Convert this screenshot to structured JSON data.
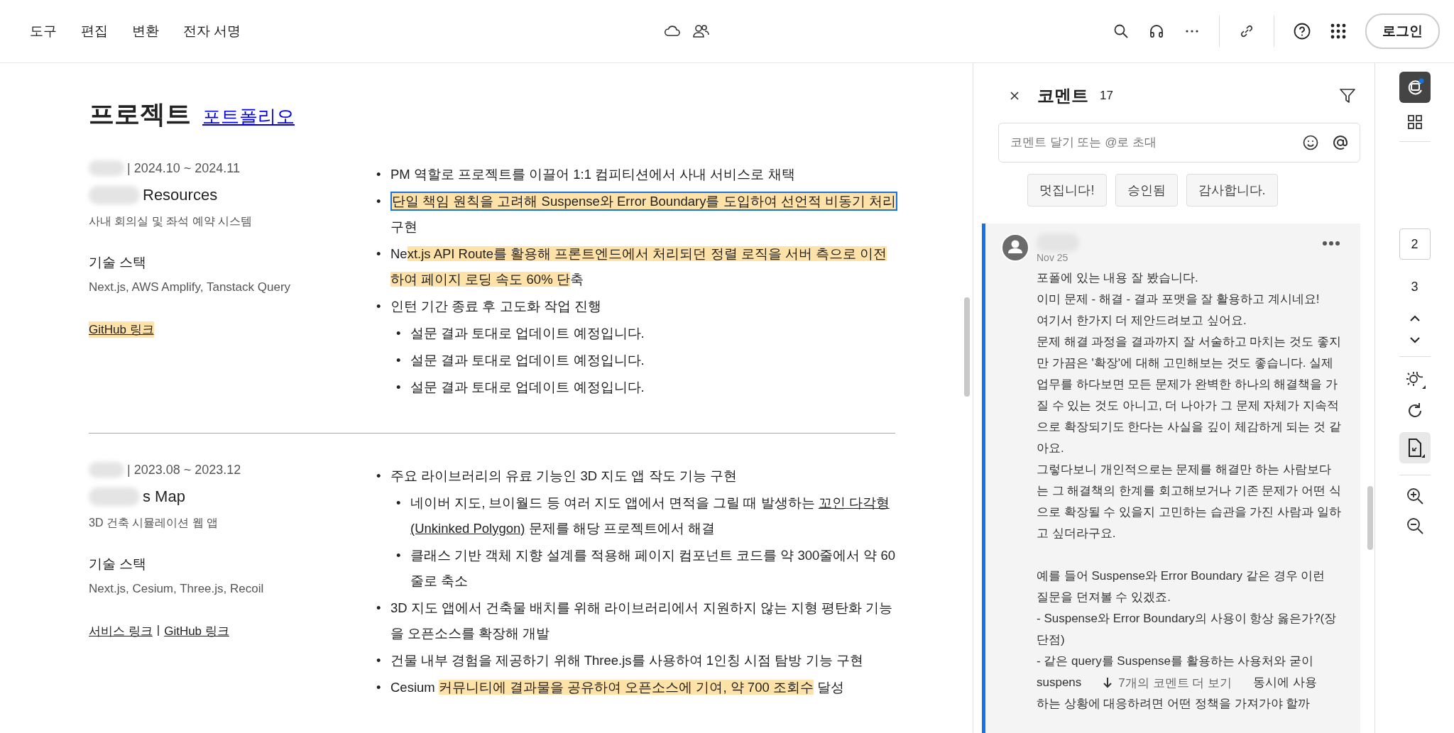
{
  "menu": [
    {
      "label": "도구"
    },
    {
      "label": "편집"
    },
    {
      "label": "변환"
    },
    {
      "label": "전자 서명"
    }
  ],
  "login_button": "로그인",
  "document": {
    "title": "프로젝트",
    "title_link": "포트폴리오",
    "projects": [
      {
        "period": "| 2024.10 ~ 2024.11",
        "name": "Resources",
        "description": "사내 회의실 및 좌석 예약 시스템",
        "stack_heading": "기술 스택",
        "stack": "Next.js, AWS Amplify, Tanstack Query",
        "links": [
          {
            "label": "GitHub 링크",
            "highlighted": true
          }
        ],
        "bullets": [
          {
            "marker": "•",
            "segments": [
              {
                "text": "PM 역할로 프로젝트를 이끌어 1:1 컴피티션에서 사내 서비스로 채택",
                "highlighted": false,
                "link": false
              }
            ]
          },
          {
            "marker": "•",
            "segments": [
              {
                "text": "단일 책임 원칙을 고려해 Suspense와 Error Boundary를 도입하여 선언적 비동기 처리",
                "highlighted": true,
                "link": false,
                "selected": true
              },
              {
                "text": " 구현",
                "highlighted": false,
                "link": false
              }
            ]
          },
          {
            "marker": "•",
            "segments": [
              {
                "text": "Ne",
                "highlighted": false,
                "link": false
              },
              {
                "text": "xt.js API Route를 활용해 프론트엔드에서 처리되던 정렬 로직을 서버 측으로 이전하여 페이지 로딩 속도 60% 단",
                "highlighted": true,
                "link": false
              },
              {
                "text": "축",
                "highlighted": false,
                "link": false
              }
            ]
          },
          {
            "marker": "•",
            "segments": [
              {
                "text": "인턴 기간 종료 후 고도화 작업 진행",
                "highlighted": false,
                "link": false
              }
            ],
            "children": [
              {
                "marker": "•",
                "segments": [
                  {
                    "text": "설문 결과 토대로 업데이트 예정입니다.",
                    "highlighted": false,
                    "link": false
                  }
                ]
              },
              {
                "marker": "•",
                "segments": [
                  {
                    "text": "설문 결과 토대로 업데이트 예정입니다.",
                    "highlighted": false,
                    "link": false
                  }
                ]
              },
              {
                "marker": "•",
                "segments": [
                  {
                    "text": "설문 결과 토대로 업데이트 예정입니다.",
                    "highlighted": false,
                    "link": false
                  }
                ]
              }
            ]
          }
        ]
      },
      {
        "period": "| 2023.08 ~ 2023.12",
        "name": "s Map",
        "description": "3D 건축 시뮬레이션 웹 앱",
        "stack_heading": "기술 스택",
        "stack": "Next.js, Cesium, Three.js, Recoil",
        "links": [
          {
            "label": "서비스 링크",
            "highlighted": false
          },
          {
            "separator": "|",
            "label": "GitHub 링크",
            "highlighted": false
          }
        ],
        "bullets": [
          {
            "marker": "•",
            "segments": [
              {
                "text": "주요 라이브러리의 유료 기능인 3D 지도 앱 작도 기능 구현",
                "highlighted": false,
                "link": false
              }
            ],
            "children": [
              {
                "marker": "•",
                "segments": [
                  {
                    "text": "네이버 지도, 브이월드 등 여러 지도 앱에서 면적을 그릴 때 발생하는 ",
                    "highlighted": false,
                    "link": false
                  },
                  {
                    "text": "꼬인 다각형 (Unkinked Polygon)",
                    "highlighted": false,
                    "link": true
                  },
                  {
                    "text": " 문제를 해당 프로젝트에서 해결",
                    "highlighted": false,
                    "link": false
                  }
                ]
              },
              {
                "marker": "•",
                "segments": [
                  {
                    "text": "클래스 기반 객체 지향 설계를 적용해 페이지 컴포넌트 코드를 약 300줄에서 약 60줄로 축소",
                    "highlighted": false,
                    "link": false
                  }
                ]
              }
            ]
          },
          {
            "marker": "•",
            "segments": [
              {
                "text": "3D 지도 앱에서 건축물 배치를 위해 라이브러리에서 지원하지 않는 지형 평탄화 기능을 오픈소스를 확장해 개발",
                "highlighted": false,
                "link": false
              }
            ]
          },
          {
            "marker": "•",
            "segments": [
              {
                "text": "건물 내부 경험을 제공하기 위해 Three.js를 사용하여 1인칭 시점 탐방 기능 구현",
                "highlighted": false,
                "link": false
              }
            ]
          },
          {
            "marker": "•",
            "segments": [
              {
                "text": "Cesium ",
                "highlighted": false,
                "link": false
              },
              {
                "text": "커뮤니티에 결과물을 공유하여 오픈소스에 기여, 약 700 조회수",
                "highlighted": true,
                "link": false
              },
              {
                "text": " 달성",
                "highlighted": false,
                "link": false
              }
            ]
          }
        ]
      }
    ]
  },
  "comments": {
    "title": "코멘트",
    "count": "17",
    "placeholder": "코멘트 달기 또는 @로 초대",
    "quick_replies": [
      "멋집니다!",
      "승인됨",
      "감사합니다."
    ],
    "thread": {
      "date": "Nov 25",
      "paragraphs": [
        [
          {
            "kind": "text",
            "text": "포폴에 있는 내용 잘 봤습니다."
          },
          {
            "kind": "text",
            "text": "이미 문제 - 해결 - 결과 포맷을 잘 활용하고 계시네요!"
          },
          {
            "kind": "text",
            "text": "여기서 한가지 더 제안드려보고 싶어요."
          },
          {
            "kind": "text",
            "text": "문제 해결 과정을 결과까지 잘 서술하고 마치는 것도 좋지"
          },
          {
            "kind": "text",
            "text": "만 가끔은 '확장'에 대해 고민해보는 것도 좋습니다. 실제"
          },
          {
            "kind": "text",
            "text": "업무를 하다보면 모든 문제가 완벽한 하나의 해결책을 가"
          },
          {
            "kind": "text",
            "text": "질 수 있는 것도 아니고, 더 나아가 그 문제 자체가 지속적"
          },
          {
            "kind": "text",
            "text": "으로 확장되기도 한다는 사실을 깊이 체감하게 되는 것 같"
          },
          {
            "kind": "text",
            "text": "아요."
          },
          {
            "kind": "text",
            "text": "그렇다보니 개인적으로는 문제를 해결만 하는 사람보다"
          },
          {
            "kind": "text",
            "text": "는 그 해결책의 한계를 회고해보거나 기존 문제가 어떤 식"
          },
          {
            "kind": "text",
            "text": "으로 확장될 수 있을지 고민하는 습관을 가진 사람과 일하"
          },
          {
            "kind": "text",
            "text": "고 싶더라구요."
          }
        ],
        [
          {
            "kind": "text",
            "text": "예를 들어 Suspense와 Error Boundary 같은 경우 이런"
          },
          {
            "kind": "text",
            "text": "질문을 던져볼 수 있겠죠."
          },
          {
            "kind": "text",
            "text": "- Suspense와 Error Boundary의 사용이 항상 옳은가?(장"
          },
          {
            "kind": "text",
            "text": "단점)"
          },
          {
            "kind": "text",
            "text": "- 같은 query를 Suspense를 활용하는 사용처와 굳이"
          },
          {
            "kind": "covered",
            "left": "suspens",
            "right": "동시에 사용"
          },
          {
            "kind": "text",
            "text": "하는 상황에 대응하려면 어떤 정책을 가져가야 할까"
          }
        ]
      ]
    },
    "more_button": "7개의 코멘트 더 보기"
  },
  "pages": [
    {
      "label": "2",
      "selected": true
    },
    {
      "label": "3",
      "selected": false
    }
  ]
}
